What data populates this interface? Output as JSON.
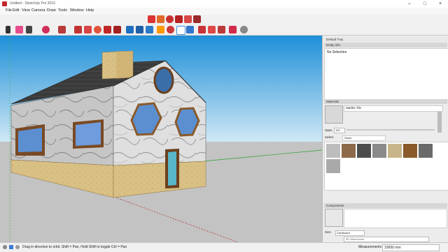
{
  "app": {
    "title": "Untitled - SketchUp Pro 2019"
  },
  "menu": {
    "items": [
      "File",
      "Edit",
      "View",
      "Camera",
      "Draw",
      "Tools",
      "Window",
      "Help"
    ]
  },
  "tray": {
    "entity_info": {
      "title": "Default Tray",
      "section": "Entity Info",
      "selection_text": "No Selection"
    },
    "materials": {
      "section": "Materials",
      "material_name": "Marble Tile",
      "opacity_label": "Opac",
      "opacity_value": "100",
      "tab_select": "Select",
      "library_name": "Stone"
    },
    "components": {
      "section": "Components",
      "size_label": "Size",
      "size_value": "Cardboard",
      "search_placeholder": "3D Warehouse"
    }
  },
  "statusbar": {
    "hint": "Drag in direction to orbit. Shift = Pan, Hold Shift to toggle Ctrl = Pan",
    "measurements_label": "Measurements",
    "measurements_value": "10000 mm"
  },
  "colors": {
    "sky_top": "#1e8fd8",
    "sky_bottom": "#cfe8f5",
    "ground": "#c3c3c3",
    "wood": "#8a5a2b",
    "sandstone": "#d9c084"
  }
}
